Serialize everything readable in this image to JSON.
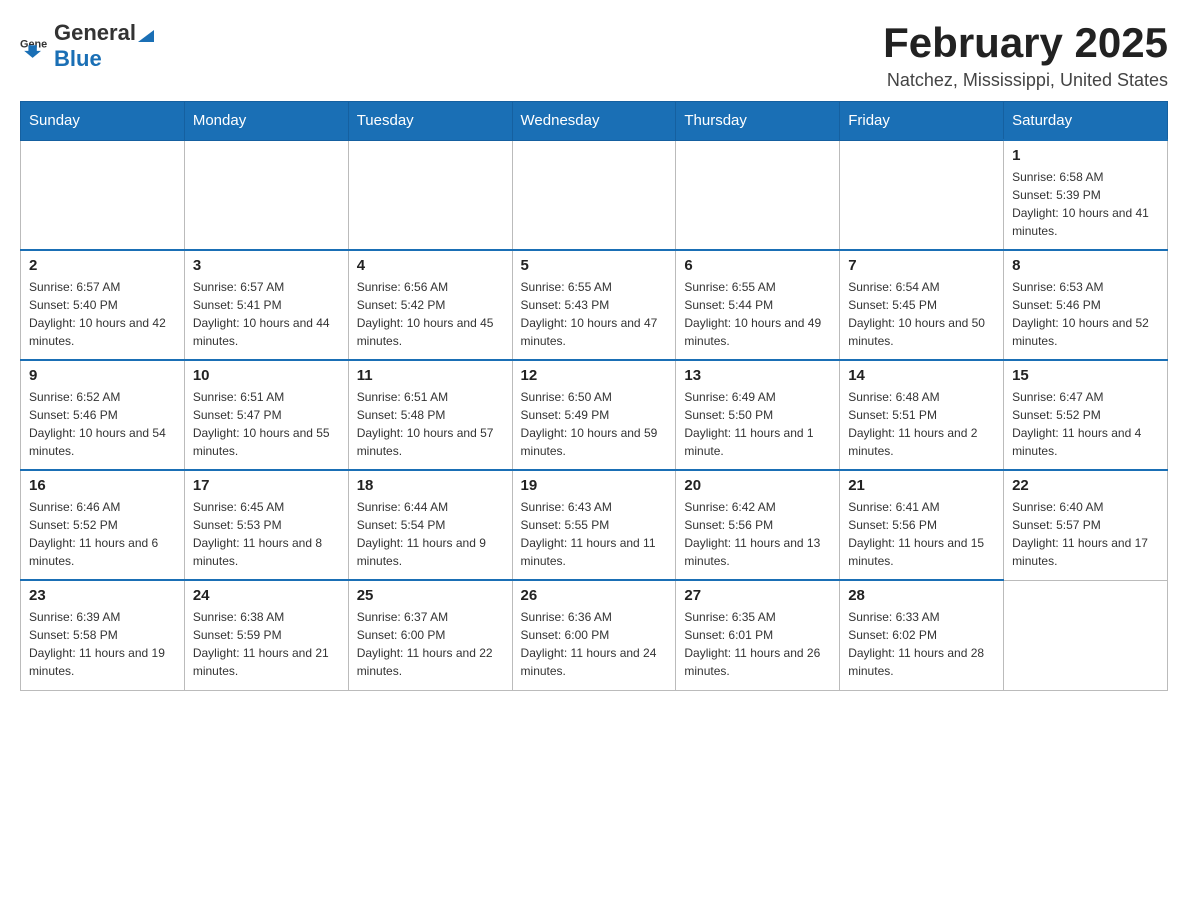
{
  "header": {
    "logo_general": "General",
    "logo_blue": "Blue",
    "month": "February 2025",
    "location": "Natchez, Mississippi, United States"
  },
  "days_of_week": [
    "Sunday",
    "Monday",
    "Tuesday",
    "Wednesday",
    "Thursday",
    "Friday",
    "Saturday"
  ],
  "weeks": [
    [
      {
        "day": "",
        "info": ""
      },
      {
        "day": "",
        "info": ""
      },
      {
        "day": "",
        "info": ""
      },
      {
        "day": "",
        "info": ""
      },
      {
        "day": "",
        "info": ""
      },
      {
        "day": "",
        "info": ""
      },
      {
        "day": "1",
        "info": "Sunrise: 6:58 AM\nSunset: 5:39 PM\nDaylight: 10 hours and 41 minutes."
      }
    ],
    [
      {
        "day": "2",
        "info": "Sunrise: 6:57 AM\nSunset: 5:40 PM\nDaylight: 10 hours and 42 minutes."
      },
      {
        "day": "3",
        "info": "Sunrise: 6:57 AM\nSunset: 5:41 PM\nDaylight: 10 hours and 44 minutes."
      },
      {
        "day": "4",
        "info": "Sunrise: 6:56 AM\nSunset: 5:42 PM\nDaylight: 10 hours and 45 minutes."
      },
      {
        "day": "5",
        "info": "Sunrise: 6:55 AM\nSunset: 5:43 PM\nDaylight: 10 hours and 47 minutes."
      },
      {
        "day": "6",
        "info": "Sunrise: 6:55 AM\nSunset: 5:44 PM\nDaylight: 10 hours and 49 minutes."
      },
      {
        "day": "7",
        "info": "Sunrise: 6:54 AM\nSunset: 5:45 PM\nDaylight: 10 hours and 50 minutes."
      },
      {
        "day": "8",
        "info": "Sunrise: 6:53 AM\nSunset: 5:46 PM\nDaylight: 10 hours and 52 minutes."
      }
    ],
    [
      {
        "day": "9",
        "info": "Sunrise: 6:52 AM\nSunset: 5:46 PM\nDaylight: 10 hours and 54 minutes."
      },
      {
        "day": "10",
        "info": "Sunrise: 6:51 AM\nSunset: 5:47 PM\nDaylight: 10 hours and 55 minutes."
      },
      {
        "day": "11",
        "info": "Sunrise: 6:51 AM\nSunset: 5:48 PM\nDaylight: 10 hours and 57 minutes."
      },
      {
        "day": "12",
        "info": "Sunrise: 6:50 AM\nSunset: 5:49 PM\nDaylight: 10 hours and 59 minutes."
      },
      {
        "day": "13",
        "info": "Sunrise: 6:49 AM\nSunset: 5:50 PM\nDaylight: 11 hours and 1 minute."
      },
      {
        "day": "14",
        "info": "Sunrise: 6:48 AM\nSunset: 5:51 PM\nDaylight: 11 hours and 2 minutes."
      },
      {
        "day": "15",
        "info": "Sunrise: 6:47 AM\nSunset: 5:52 PM\nDaylight: 11 hours and 4 minutes."
      }
    ],
    [
      {
        "day": "16",
        "info": "Sunrise: 6:46 AM\nSunset: 5:52 PM\nDaylight: 11 hours and 6 minutes."
      },
      {
        "day": "17",
        "info": "Sunrise: 6:45 AM\nSunset: 5:53 PM\nDaylight: 11 hours and 8 minutes."
      },
      {
        "day": "18",
        "info": "Sunrise: 6:44 AM\nSunset: 5:54 PM\nDaylight: 11 hours and 9 minutes."
      },
      {
        "day": "19",
        "info": "Sunrise: 6:43 AM\nSunset: 5:55 PM\nDaylight: 11 hours and 11 minutes."
      },
      {
        "day": "20",
        "info": "Sunrise: 6:42 AM\nSunset: 5:56 PM\nDaylight: 11 hours and 13 minutes."
      },
      {
        "day": "21",
        "info": "Sunrise: 6:41 AM\nSunset: 5:56 PM\nDaylight: 11 hours and 15 minutes."
      },
      {
        "day": "22",
        "info": "Sunrise: 6:40 AM\nSunset: 5:57 PM\nDaylight: 11 hours and 17 minutes."
      }
    ],
    [
      {
        "day": "23",
        "info": "Sunrise: 6:39 AM\nSunset: 5:58 PM\nDaylight: 11 hours and 19 minutes."
      },
      {
        "day": "24",
        "info": "Sunrise: 6:38 AM\nSunset: 5:59 PM\nDaylight: 11 hours and 21 minutes."
      },
      {
        "day": "25",
        "info": "Sunrise: 6:37 AM\nSunset: 6:00 PM\nDaylight: 11 hours and 22 minutes."
      },
      {
        "day": "26",
        "info": "Sunrise: 6:36 AM\nSunset: 6:00 PM\nDaylight: 11 hours and 24 minutes."
      },
      {
        "day": "27",
        "info": "Sunrise: 6:35 AM\nSunset: 6:01 PM\nDaylight: 11 hours and 26 minutes."
      },
      {
        "day": "28",
        "info": "Sunrise: 6:33 AM\nSunset: 6:02 PM\nDaylight: 11 hours and 28 minutes."
      },
      {
        "day": "",
        "info": ""
      }
    ]
  ]
}
